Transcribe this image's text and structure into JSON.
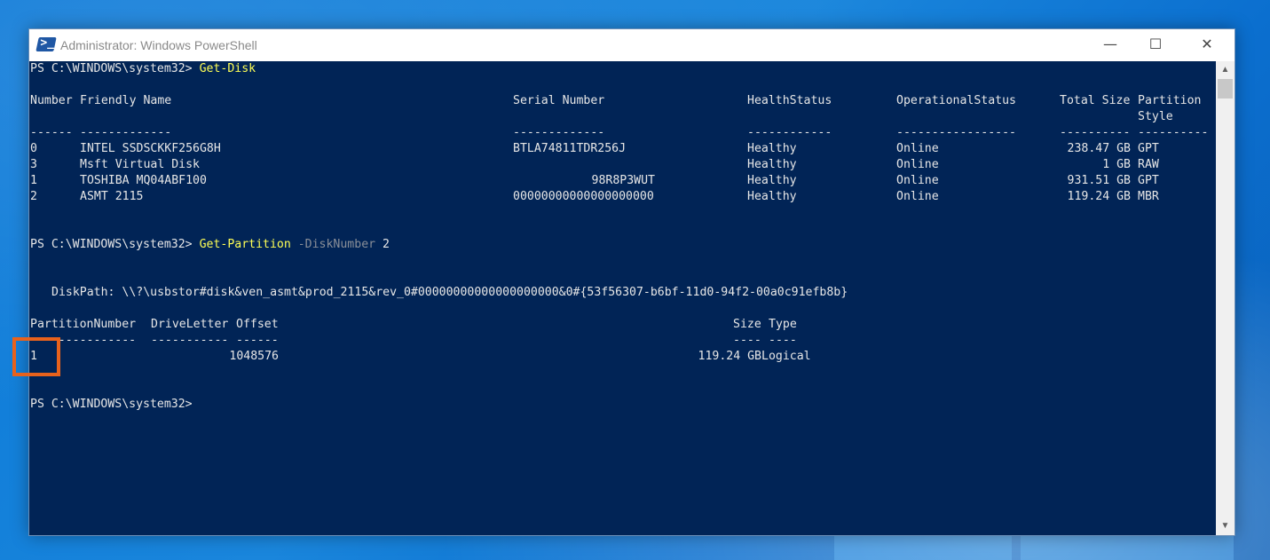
{
  "window": {
    "title": "Administrator: Windows PowerShell",
    "minimize": "—",
    "maximize": "☐",
    "close": "✕"
  },
  "console": {
    "prompt1": "PS C:\\WINDOWS\\system32> ",
    "command1": "Get-Disk",
    "disk_headers": {
      "number": "Number",
      "friendly": "Friendly Name",
      "serial": "Serial Number",
      "health": "HealthStatus",
      "operational": "OperationalStatus",
      "total": "Total Size",
      "partition": "Partition",
      "style": "Style"
    },
    "disk_dashes": {
      "number": "------",
      "friendly": "-------------",
      "serial": "-------------",
      "health": "------------",
      "operational": "-----------------",
      "total": "----------",
      "partition": "----------"
    },
    "disks": [
      {
        "number": "0",
        "friendly": "INTEL SSDSCKKF256G8H",
        "serial": "BTLA74811TDR256J",
        "health": "Healthy",
        "operational": "Online",
        "total": "238.47 GB",
        "style": "GPT"
      },
      {
        "number": "3",
        "friendly": "Msft Virtual Disk",
        "serial": "",
        "health": "Healthy",
        "operational": "Online",
        "total": "1 GB",
        "style": "RAW"
      },
      {
        "number": "1",
        "friendly": "TOSHIBA MQ04ABF100",
        "serial": "98R8P3WUT",
        "health": "Healthy",
        "operational": "Online",
        "total": "931.51 GB",
        "style": "GPT"
      },
      {
        "number": "2",
        "friendly": "ASMT 2115",
        "serial": "00000000000000000000",
        "health": "Healthy",
        "operational": "Online",
        "total": "119.24 GB",
        "style": "MBR"
      }
    ],
    "prompt2": "PS C:\\WINDOWS\\system32> ",
    "command2": "Get-Partition",
    "param2": "-DiskNumber",
    "arg2": "2",
    "diskpath": "DiskPath: \\\\?\\usbstor#disk&ven_asmt&prod_2115&rev_0#00000000000000000000&0#{53f56307-b6bf-11d0-94f2-00a0c91efb8b}",
    "part_headers": {
      "number": "PartitionNumber",
      "letter": "DriveLetter",
      "offset": "Offset",
      "size": "Size",
      "type": "Type"
    },
    "part_dashes": {
      "number": "---------------",
      "letter": "-----------",
      "offset": "------",
      "size": "----",
      "type": "----"
    },
    "partitions": [
      {
        "number": "1",
        "letter": "",
        "offset": "1048576",
        "size": "119.24 GB",
        "type": "Logical"
      }
    ],
    "prompt3": "PS C:\\WINDOWS\\system32>"
  },
  "colors": {
    "console_bg": "#012456",
    "command": "#ffff55",
    "parameter": "#8a8f98",
    "highlight": "#e8621c"
  },
  "icons": [
    "powershell-icon",
    "scroll-up-icon",
    "scroll-down-icon"
  ]
}
